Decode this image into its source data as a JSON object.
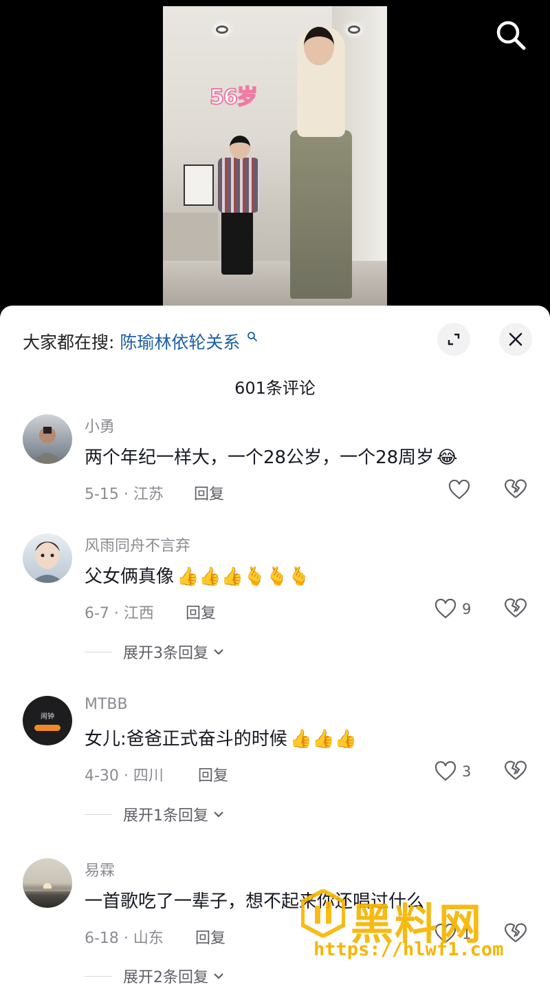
{
  "video": {
    "overlay_text": "56岁"
  },
  "search": {
    "icon": "search-icon"
  },
  "sheet": {
    "search_hint_prefix": "大家都在搜:",
    "search_hint_term": "陈瑜林依轮关系",
    "comment_count": "601条评论",
    "expand_icon": "expand-icon",
    "close_icon": "close-icon"
  },
  "comments": [
    {
      "username": "小勇",
      "text": "两个年纪一样大，一个28公岁，一个28周岁",
      "emoji": "😂",
      "meta": "5-15 · 江苏",
      "reply_label": "回复",
      "likes": ""
    },
    {
      "username": "风雨同舟不言弃",
      "text": "父女俩真像",
      "emoji": "👍👍👍🫰🫰🫰",
      "meta": "6-7 · 江西",
      "reply_label": "回复",
      "likes": "9",
      "expand_label": "展开3条回复"
    },
    {
      "username": "MTBB",
      "text": "女儿:爸爸正式奋斗的时候",
      "emoji": "👍👍👍",
      "meta": "4-30 · 四川",
      "reply_label": "回复",
      "likes": "3",
      "expand_label": "展开1条回复",
      "avatar_text": "闹钟"
    },
    {
      "username": "易霖",
      "text": "一首歌吃了一辈子，想不起来你还唱过什么",
      "emoji": "",
      "meta": "6-18 · 山东",
      "reply_label": "回复",
      "likes": "1",
      "expand_label": "展开2条回复"
    }
  ],
  "watermark": {
    "title": "黑料网",
    "url": "https://hlwf1.com"
  },
  "colors": {
    "link": "#1b5fa8",
    "muted": "#8a8b91",
    "watermark": "#f7b500"
  }
}
